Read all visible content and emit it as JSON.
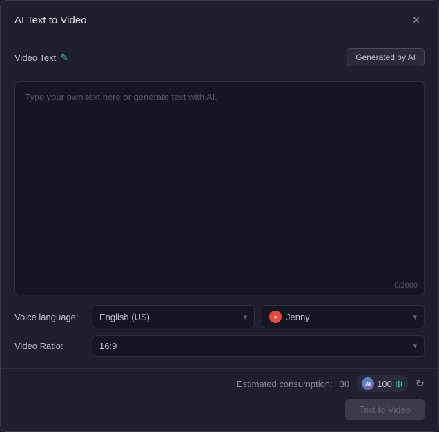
{
  "dialog": {
    "title": "AI Text to Video",
    "close_label": "×"
  },
  "video_text_section": {
    "label": "Video Text",
    "edit_icon": "✎",
    "generated_by_ai_label": "Generated by AI",
    "textarea_placeholder": "Type your own text here or generate text with AI.",
    "char_count": "0/2000"
  },
  "voice_language": {
    "label": "Voice language:",
    "selected": "English (US)",
    "chevron": "▾"
  },
  "voice_name": {
    "selected": "Jenny",
    "icon_label": "●",
    "chevron": "▾"
  },
  "video_ratio": {
    "label": "Video Ratio:",
    "selected": "16:9",
    "chevron": "▾"
  },
  "footer": {
    "estimated_consumption_label": "Estimated consumption:",
    "consumption_value": "30",
    "ai_icon_label": "AI",
    "credits": "100",
    "plus_icon": "⊕",
    "refresh_icon": "↻",
    "text_to_video_btn": "Text to Video"
  }
}
